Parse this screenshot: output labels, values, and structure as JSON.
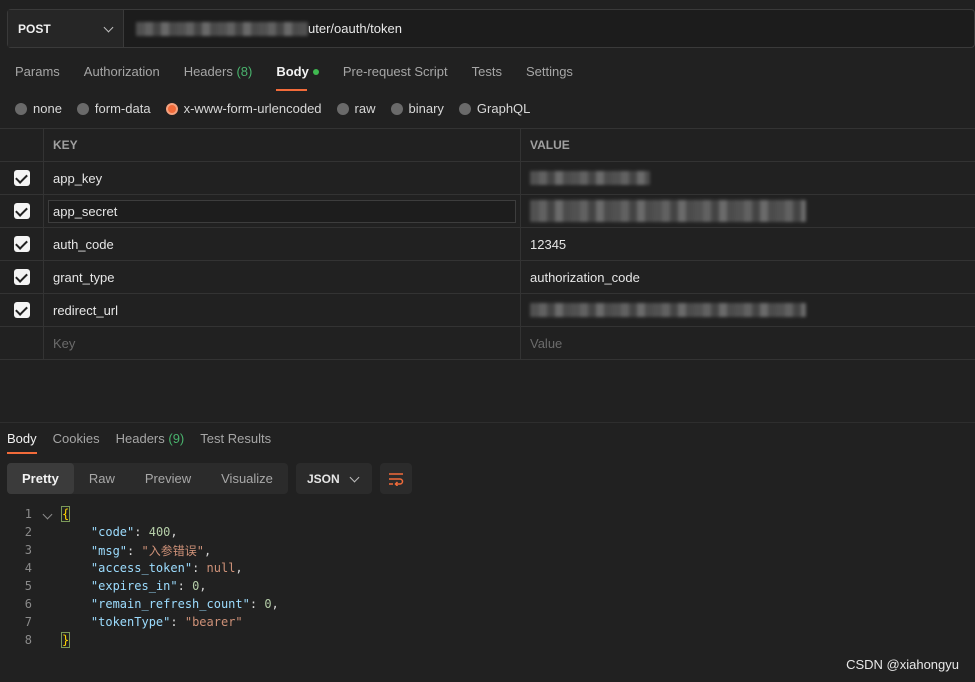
{
  "request": {
    "method": "POST",
    "url_visible": "uter/oauth/token"
  },
  "tabs": [
    {
      "label": "Params"
    },
    {
      "label": "Authorization"
    },
    {
      "label": "Headers",
      "count": "(8)"
    },
    {
      "label": "Body"
    },
    {
      "label": "Pre-request Script"
    },
    {
      "label": "Tests"
    },
    {
      "label": "Settings"
    }
  ],
  "body_types": [
    "none",
    "form-data",
    "x-www-form-urlencoded",
    "raw",
    "binary",
    "GraphQL"
  ],
  "body_selected": "x-www-form-urlencoded",
  "table": {
    "headers": {
      "key": "KEY",
      "value": "VALUE"
    },
    "rows": [
      {
        "key": "app_key",
        "value": ""
      },
      {
        "key": "app_secret",
        "value": ""
      },
      {
        "key": "auth_code",
        "value": "12345"
      },
      {
        "key": "grant_type",
        "value": "authorization_code"
      },
      {
        "key": "redirect_url",
        "value": ""
      }
    ],
    "placeholder": {
      "key": "Key",
      "value": "Value"
    }
  },
  "response": {
    "tabs": [
      {
        "label": "Body"
      },
      {
        "label": "Cookies"
      },
      {
        "label": "Headers",
        "count": "(9)"
      },
      {
        "label": "Test Results"
      }
    ],
    "views": [
      "Pretty",
      "Raw",
      "Preview",
      "Visualize"
    ],
    "format": "JSON",
    "lines": [
      "1",
      "2",
      "3",
      "4",
      "5",
      "6",
      "7",
      "8"
    ],
    "json": {
      "code_key": "\"code\"",
      "code_val": "400",
      "msg_key": "\"msg\"",
      "msg_val": "\"入参错误\"",
      "access_token_key": "\"access_token\"",
      "access_token_val": "null",
      "expires_in_key": "\"expires_in\"",
      "expires_in_val": "0",
      "remain_key": "\"remain_refresh_count\"",
      "remain_val": "0",
      "tokenType_key": "\"tokenType\"",
      "tokenType_val": "\"bearer\""
    }
  },
  "watermark": "CSDN @xiahongyu",
  "colors": {
    "accent": "#f26b3a",
    "green": "#49b36d",
    "bg": "#212121"
  }
}
